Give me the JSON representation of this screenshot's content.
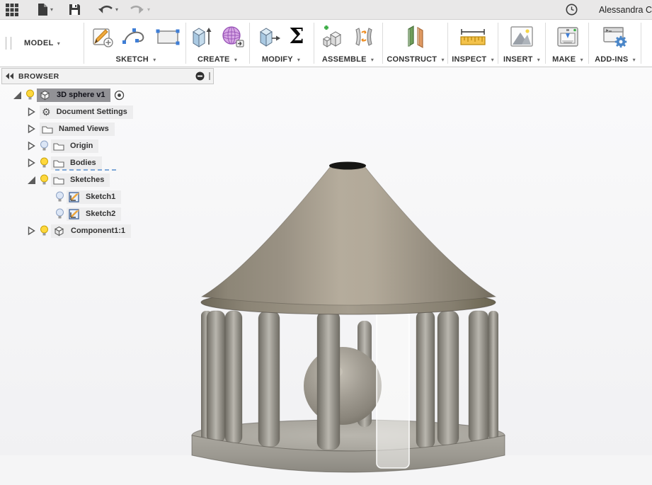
{
  "topbar": {
    "user": "Alessandra C",
    "icons": [
      "app-grid",
      "file-new",
      "save",
      "undo",
      "redo",
      "clock"
    ]
  },
  "workspace": {
    "label": "MODEL"
  },
  "toolbar": {
    "sigma_glyph": "Σ",
    "groups": [
      {
        "label": "SKETCH",
        "icons": [
          "create-sketch",
          "spline",
          "rectangle"
        ]
      },
      {
        "label": "CREATE",
        "icons": [
          "extrude",
          "form"
        ]
      },
      {
        "label": "MODIFY",
        "icons": [
          "press-pull",
          "change-parameters-sigma"
        ]
      },
      {
        "label": "ASSEMBLE",
        "icons": [
          "new-component",
          "joint"
        ]
      },
      {
        "label": "CONSTRUCT",
        "icons": [
          "construction-plane"
        ]
      },
      {
        "label": "INSPECT",
        "icons": [
          "measure"
        ]
      },
      {
        "label": "INSERT",
        "icons": [
          "insert-image"
        ]
      },
      {
        "label": "MAKE",
        "icons": [
          "3d-print"
        ]
      },
      {
        "label": "ADD-INS",
        "icons": [
          "scripts-addins"
        ]
      }
    ]
  },
  "browser": {
    "title": "BROWSER",
    "rows": [
      {
        "label": "3D sphere v1",
        "level": 0,
        "expander": "expanded",
        "bulb": "on",
        "icon": "component",
        "selected": true,
        "activated": true
      },
      {
        "label": "Document Settings",
        "level": 1,
        "expander": "collapsed",
        "bulb": "none",
        "icon": "gear"
      },
      {
        "label": "Named Views",
        "level": 1,
        "expander": "collapsed",
        "bulb": "none",
        "icon": "folder"
      },
      {
        "label": "Origin",
        "level": 1,
        "expander": "collapsed",
        "bulb": "off",
        "icon": "folder"
      },
      {
        "label": "Bodies",
        "level": 1,
        "expander": "collapsed",
        "bulb": "on",
        "icon": "folder",
        "decorated": true
      },
      {
        "label": "Sketches",
        "level": 1,
        "expander": "expanded",
        "bulb": "on",
        "icon": "folder"
      },
      {
        "label": "Sketch1",
        "level": 2,
        "expander": "none",
        "bulb": "off",
        "icon": "sketch"
      },
      {
        "label": "Sketch2",
        "level": 2,
        "expander": "none",
        "bulb": "off",
        "icon": "sketch"
      },
      {
        "label": "Component1:1",
        "level": 1,
        "expander": "collapsed",
        "bulb": "on",
        "icon": "component"
      }
    ]
  },
  "viewport": {
    "model": "cage with cone roof, inner sphere, columns and circular base",
    "colors": {
      "metal_light": "#b5ac9c",
      "metal_mid": "#9a9284",
      "metal_dark": "#756e60",
      "column_light": "#b9b6ae",
      "column_dark": "#6f6c64",
      "selection_highlight": "#929296",
      "bulb_on": "#ffd83d",
      "bulb_off": "#dce6f6",
      "background": "#f5f5f6"
    }
  }
}
